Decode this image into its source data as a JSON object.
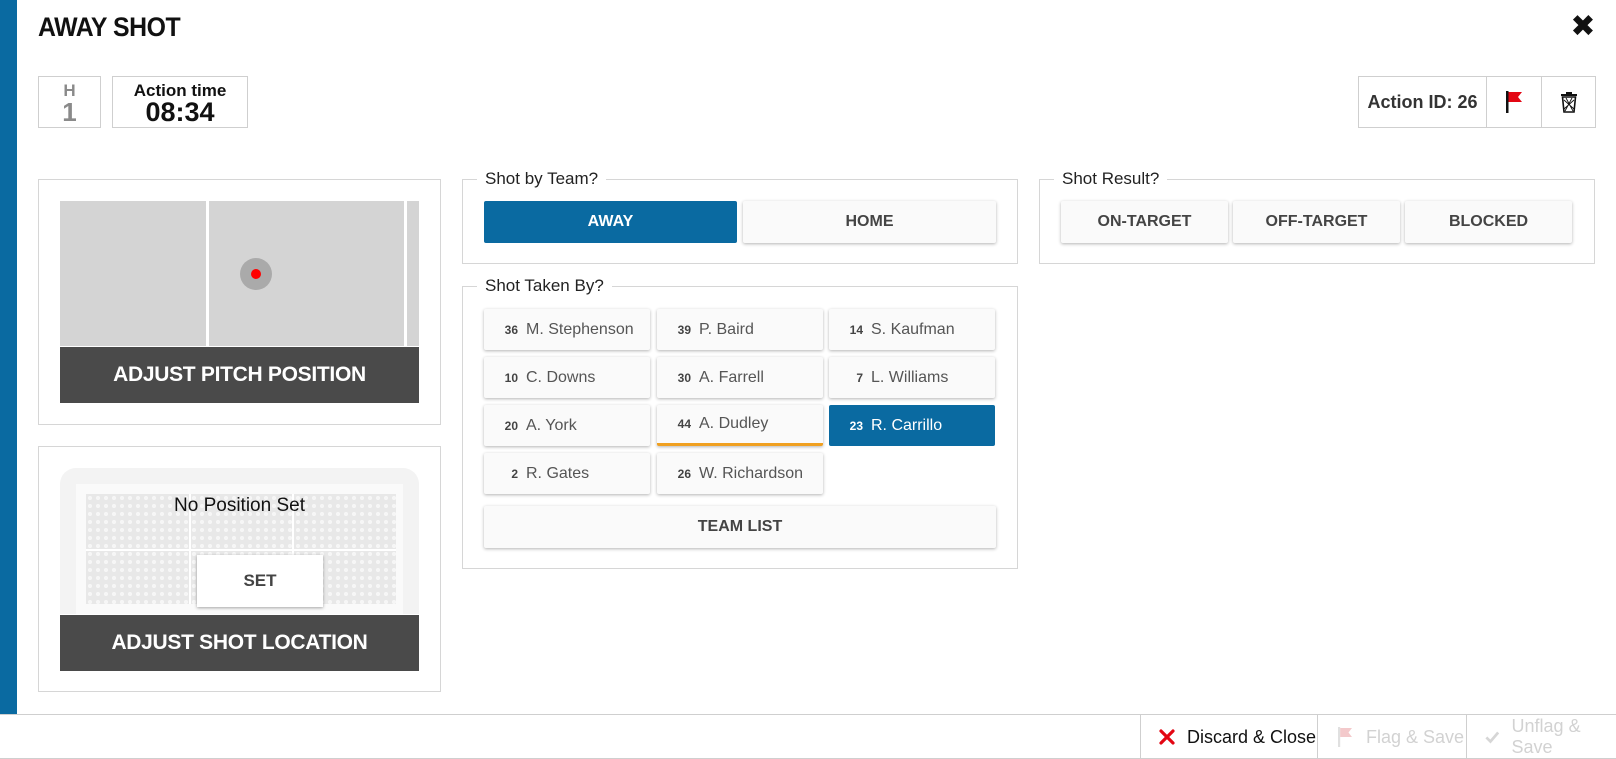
{
  "header": {
    "title": "AWAY SHOT",
    "half_label": "H",
    "half_value": "1",
    "time_label": "Action time",
    "time_value": "08:34",
    "action_id": "Action ID: 26"
  },
  "pitch": {
    "adjust_label": "ADJUST PITCH POSITION"
  },
  "shot_location": {
    "status": "No Position Set",
    "set_label": "SET",
    "adjust_label": "ADJUST SHOT LOCATION"
  },
  "shot_by_team": {
    "legend": "Shot by Team?",
    "options": [
      "AWAY",
      "HOME"
    ],
    "selected": "AWAY"
  },
  "shot_taken_by": {
    "legend": "Shot Taken By?",
    "players": [
      {
        "number": "36",
        "name": "M. Stephenson"
      },
      {
        "number": "39",
        "name": "P. Baird"
      },
      {
        "number": "14",
        "name": "S. Kaufman"
      },
      {
        "number": "10",
        "name": "C. Downs"
      },
      {
        "number": "30",
        "name": "A. Farrell"
      },
      {
        "number": "7",
        "name": "L. Williams"
      },
      {
        "number": "20",
        "name": "A. York"
      },
      {
        "number": "44",
        "name": "A. Dudley"
      },
      {
        "number": "23",
        "name": "R. Carrillo"
      },
      {
        "number": "2",
        "name": "R. Gates"
      },
      {
        "number": "26",
        "name": "W. Richardson"
      }
    ],
    "selected_player": "R. Carrillo",
    "team_list_label": "TEAM LIST"
  },
  "shot_result": {
    "legend": "Shot Result?",
    "options": [
      "ON-TARGET",
      "OFF-TARGET",
      "BLOCKED"
    ]
  },
  "footer": {
    "discard_label": "Discard & Close",
    "flag_save_label": "Flag & Save",
    "unflag_save_label": "Unflag & Save"
  },
  "colors": {
    "accent": "#0a6aa1",
    "dark_button": "#4a4a4a",
    "focus_underline": "#f0a020",
    "flag_red": "#e30613",
    "marker_red": "#ff0000"
  },
  "icons": [
    "close-icon",
    "flag-icon",
    "trash-icon",
    "discard-x-icon",
    "flag-disabled-icon",
    "check-disabled-icon"
  ]
}
